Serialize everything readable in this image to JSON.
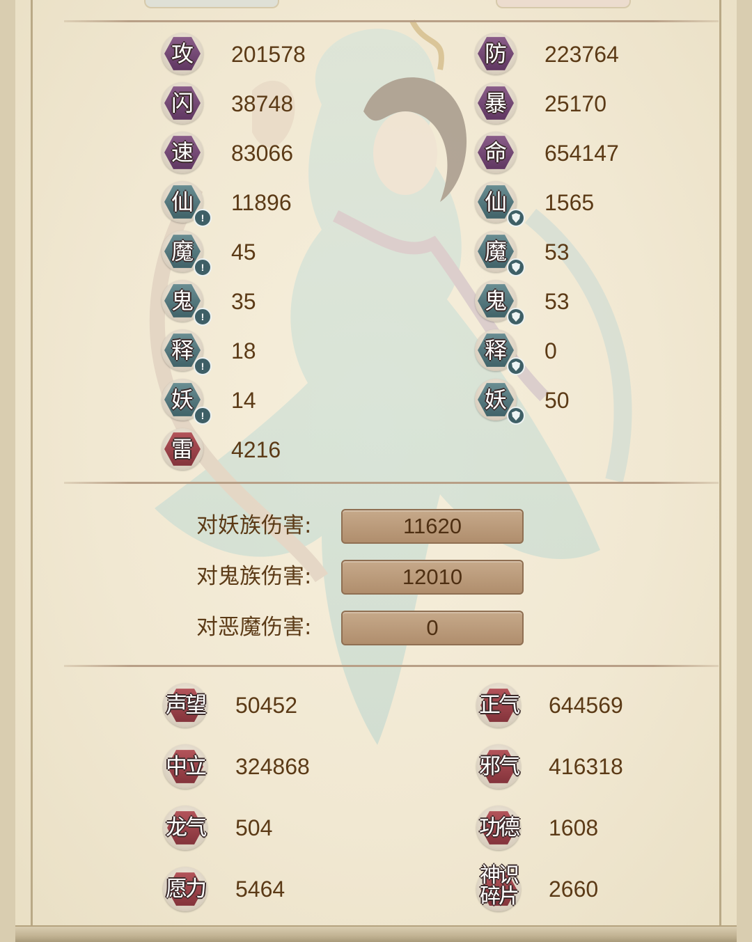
{
  "stats_left": [
    {
      "label": "攻",
      "value": "201578",
      "color": "purple",
      "marker": "none"
    },
    {
      "label": "闪",
      "value": "38748",
      "color": "purple",
      "marker": "none"
    },
    {
      "label": "速",
      "value": "83066",
      "color": "purple",
      "marker": "none"
    },
    {
      "label": "仙",
      "value": "11896",
      "color": "teal",
      "marker": "attack"
    },
    {
      "label": "魔",
      "value": "45",
      "color": "teal",
      "marker": "attack"
    },
    {
      "label": "鬼",
      "value": "35",
      "color": "teal",
      "marker": "attack"
    },
    {
      "label": "释",
      "value": "18",
      "color": "teal",
      "marker": "attack"
    },
    {
      "label": "妖",
      "value": "14",
      "color": "teal",
      "marker": "attack"
    },
    {
      "label": "雷",
      "value": "4216",
      "color": "red",
      "marker": "none"
    }
  ],
  "stats_right": [
    {
      "label": "防",
      "value": "223764",
      "color": "purple",
      "marker": "none"
    },
    {
      "label": "暴",
      "value": "25170",
      "color": "purple",
      "marker": "none"
    },
    {
      "label": "命",
      "value": "654147",
      "color": "purple",
      "marker": "none"
    },
    {
      "label": "仙",
      "value": "1565",
      "color": "teal",
      "marker": "defense"
    },
    {
      "label": "魔",
      "value": "53",
      "color": "teal",
      "marker": "defense"
    },
    {
      "label": "鬼",
      "value": "53",
      "color": "teal",
      "marker": "defense"
    },
    {
      "label": "释",
      "value": "0",
      "color": "teal",
      "marker": "defense"
    },
    {
      "label": "妖",
      "value": "50",
      "color": "teal",
      "marker": "defense"
    }
  ],
  "damage": [
    {
      "label": "对妖族伤害:",
      "value": "11620"
    },
    {
      "label": "对鬼族伤害:",
      "value": "12010"
    },
    {
      "label": "对恶魔伤害:",
      "value": "0"
    }
  ],
  "reputation_left": [
    {
      "label": "声望",
      "value": "50452"
    },
    {
      "label": "中立",
      "value": "324868"
    },
    {
      "label": "龙气",
      "value": "504"
    },
    {
      "label": "愿力",
      "value": "5464"
    }
  ],
  "reputation_right": [
    {
      "label": "正气",
      "value": "644569"
    },
    {
      "label": "邪气",
      "value": "416318"
    },
    {
      "label": "功德",
      "value": "1608"
    },
    {
      "label": "神识碎片",
      "value": "2660"
    }
  ],
  "icons": {
    "attack_marker": "exclamation-icon",
    "defense_marker": "shield-icon"
  },
  "colors": {
    "purple_badge": "#6e4470",
    "teal_badge": "#4f7378",
    "red_badge": "#9b3f47",
    "value_text": "#5b3a16",
    "damage_box": "#b99878"
  }
}
